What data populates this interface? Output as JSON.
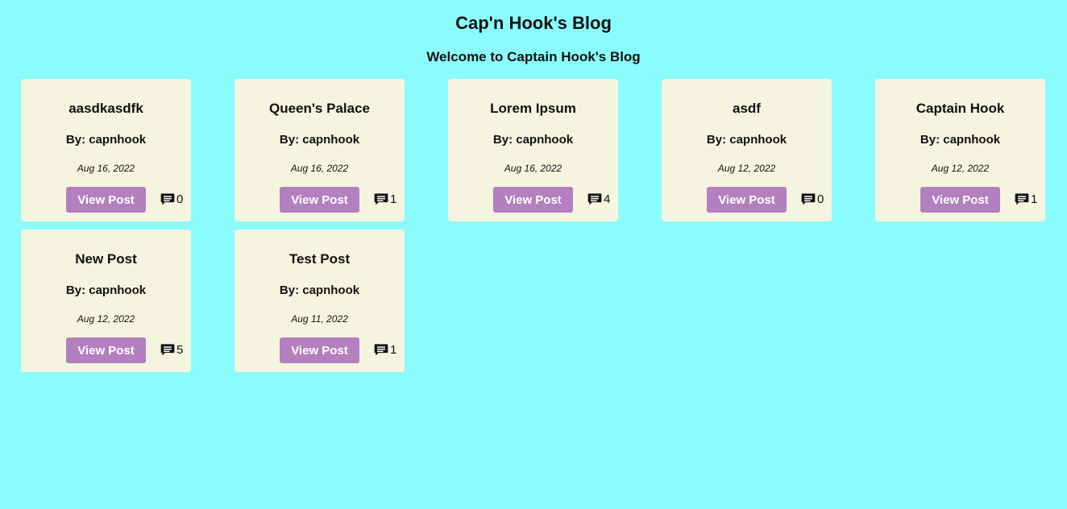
{
  "header": {
    "title": "Cap'n Hook's Blog",
    "welcome": "Welcome to Captain Hook's Blog"
  },
  "colors": {
    "background": "#8afcfc",
    "card": "#f5f4df",
    "button": "#b37fbf"
  },
  "posts": [
    {
      "title": "aasdkasdfk",
      "author": "By: capnhook",
      "date": "Aug 16, 2022",
      "button": "View Post",
      "comments": "0",
      "icon": "comment-icon"
    },
    {
      "title": "Queen's Palace",
      "author": "By: capnhook",
      "date": "Aug 16, 2022",
      "button": "View Post",
      "comments": "1",
      "icon": "comment-icon"
    },
    {
      "title": "Lorem Ipsum",
      "author": "By: capnhook",
      "date": "Aug 16, 2022",
      "button": "View Post",
      "comments": "4",
      "icon": "comment-icon"
    },
    {
      "title": "asdf",
      "author": "By: capnhook",
      "date": "Aug 12, 2022",
      "button": "View Post",
      "comments": "0",
      "icon": "comment-icon"
    },
    {
      "title": "Captain Hook",
      "author": "By: capnhook",
      "date": "Aug 12, 2022",
      "button": "View Post",
      "comments": "1",
      "icon": "comment-icon"
    },
    {
      "title": "New Post",
      "author": "By: capnhook",
      "date": "Aug 12, 2022",
      "button": "View Post",
      "comments": "5",
      "icon": "comment-icon"
    },
    {
      "title": "Test Post",
      "author": "By: capnhook",
      "date": "Aug 11, 2022",
      "button": "View Post",
      "comments": "1",
      "icon": "comment-icon"
    }
  ]
}
